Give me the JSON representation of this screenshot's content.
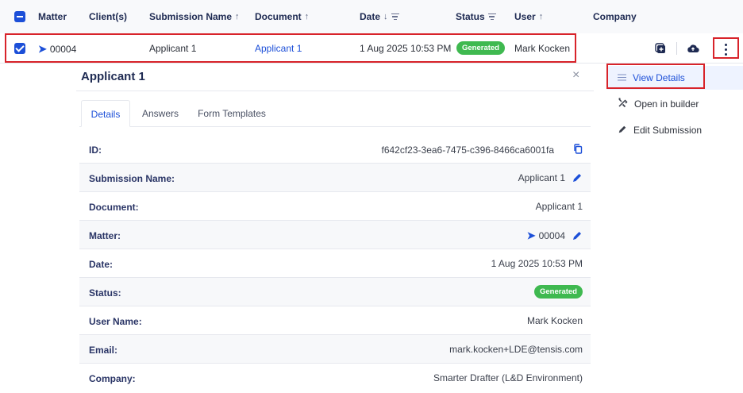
{
  "table": {
    "columns": {
      "matter": "Matter",
      "clients": "Client(s)",
      "submission_name": "Submission Name",
      "document": "Document",
      "date": "Date",
      "status": "Status",
      "user": "User",
      "company": "Company"
    },
    "sort_up": "↑",
    "sort_down": "↓",
    "row": {
      "matter": "00004",
      "submission_name": "Applicant 1",
      "document": "Applicant 1",
      "date": "1 Aug 2025 10:53 PM",
      "status": "Generated",
      "user": "Mark Kocken"
    }
  },
  "details_panel": {
    "title": "Applicant 1",
    "close": "×",
    "tabs": [
      "Details",
      "Answers",
      "Form Templates"
    ],
    "fields": {
      "id_label": "ID:",
      "id_value": "f642cf23-3ea6-7475-c396-8466ca6001fa",
      "submission_label": "Submission Name:",
      "submission_value": "Applicant 1",
      "document_label": "Document:",
      "document_value": "Applicant 1",
      "matter_label": "Matter:",
      "matter_value": "00004",
      "date_label": "Date:",
      "date_value": "1 Aug 2025 10:53 PM",
      "status_label": "Status:",
      "status_value": "Generated",
      "user_label": "User Name:",
      "user_value": "Mark Kocken",
      "email_label": "Email:",
      "email_value": "mark.kocken+LDE@tensis.com",
      "company_label": "Company:",
      "company_value": "Smarter Drafter (L&D Environment)"
    }
  },
  "context_menu": {
    "view_details": "View Details",
    "open_in_builder": "Open in builder",
    "edit_submission": "Edit Submission"
  },
  "colors": {
    "accent": "#1c4fd8",
    "status_generated": "#3fb950",
    "highlight": "#d8232a"
  }
}
